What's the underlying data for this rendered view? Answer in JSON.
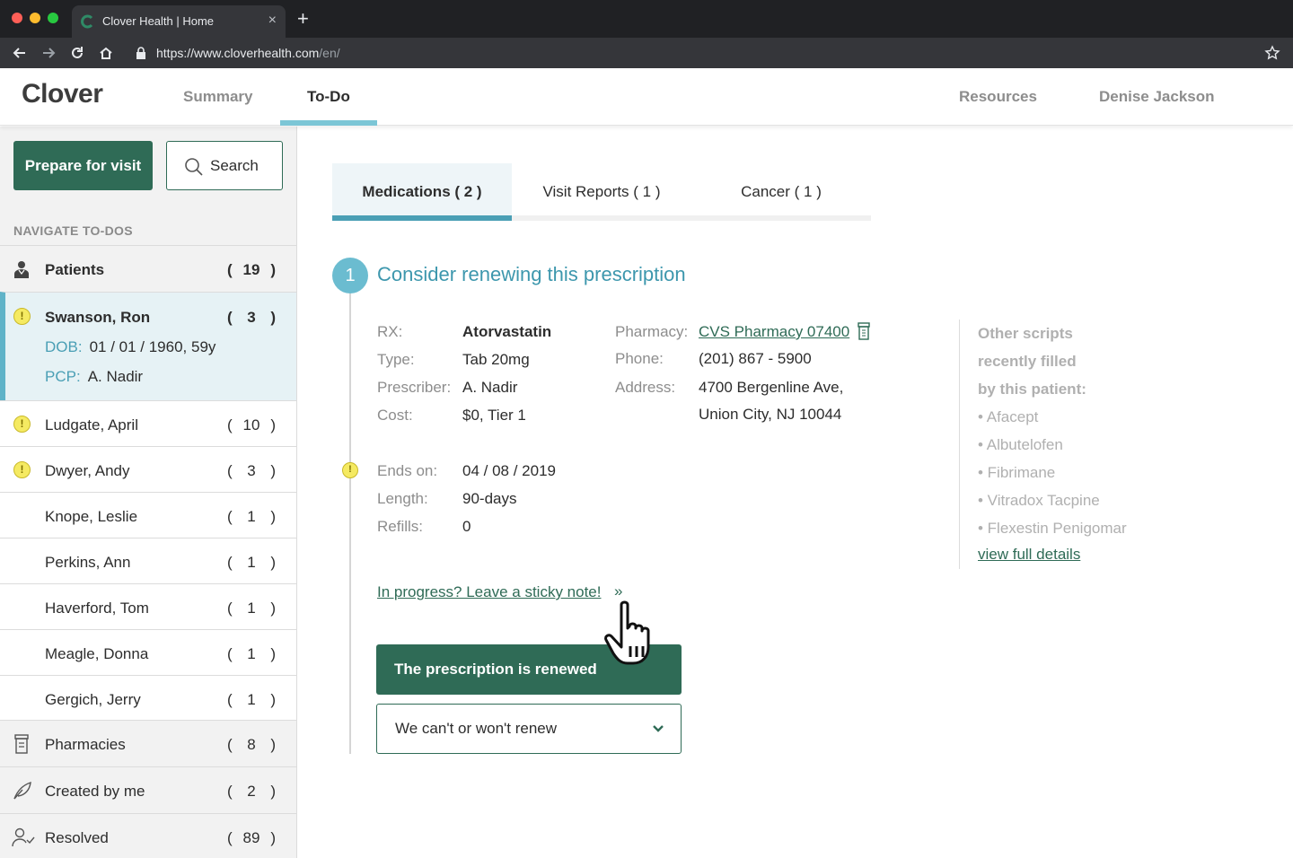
{
  "browser": {
    "tab_title": "Clover Health | Home",
    "url_main": "https://www.cloverhealth.com",
    "url_path": "/en/"
  },
  "header": {
    "logo": "Clover",
    "nav": {
      "summary": "Summary",
      "todo": "To-Do"
    },
    "resources": "Resources",
    "user_name": "Denise Jackson"
  },
  "sidebar": {
    "prepare_button": "Prepare for visit",
    "search_button": "Search",
    "heading": "NAVIGATE TO-DOS",
    "patients": {
      "label": "Patients",
      "count": "19"
    },
    "selected_patient": {
      "name": "Swanson, Ron",
      "count": "3",
      "dob_key": "DOB:",
      "dob_value": "01 / 01 / 1960, 59y",
      "pcp_key": "PCP:",
      "pcp_value": "A. Nadir"
    },
    "patient_rows": [
      {
        "name": "Ludgate, April",
        "count": "10",
        "alert": true
      },
      {
        "name": "Dwyer, Andy",
        "count": "3",
        "alert": true
      },
      {
        "name": "Knope, Leslie",
        "count": "1",
        "alert": false
      },
      {
        "name": "Perkins, Ann",
        "count": "1",
        "alert": false
      },
      {
        "name": "Haverford, Tom",
        "count": "1",
        "alert": false
      },
      {
        "name": "Meagle, Donna",
        "count": "1",
        "alert": false
      },
      {
        "name": "Gergich, Jerry",
        "count": "1",
        "alert": false
      }
    ],
    "pharmacies": {
      "label": "Pharmacies",
      "count": "8"
    },
    "created_by_me": {
      "label": "Created by me",
      "count": "2"
    },
    "resolved": {
      "label": "Resolved",
      "count": "89"
    },
    "paren_open": "(",
    "paren_close": ")"
  },
  "main": {
    "tabs": [
      {
        "label": "Medications ( 2 )"
      },
      {
        "label": "Visit Reports ( 1 )"
      },
      {
        "label": "Cancer ( 1 )"
      }
    ],
    "step_number": "1",
    "step_title": "Consider renewing this prescription",
    "rx": {
      "rx_key": "RX:",
      "rx_value": "Atorvastatin",
      "type_key": "Type:",
      "type_value": "Tab 20mg",
      "prescriber_key": "Prescriber:",
      "prescriber_value": "A. Nadir",
      "cost_key": "Cost:",
      "cost_value": "$0, Tier 1"
    },
    "pharmacy": {
      "pharmacy_key": "Pharmacy:",
      "pharmacy_value": "CVS Pharmacy 07400",
      "phone_key": "Phone:",
      "phone_value": "(201)  867 - 5900",
      "address_key": "Address:",
      "address_line1": "4700 Bergenline Ave,",
      "address_line2": "Union City, NJ  10044"
    },
    "dates": {
      "ends_key": "Ends on:",
      "ends_value": "04 / 08 / 2019",
      "length_key": "Length:",
      "length_value": "90-days",
      "refills_key": "Refills:",
      "refills_value": "0"
    },
    "other_scripts": {
      "heading_lines": [
        "Other scripts",
        "recently filled",
        "by this patient:"
      ],
      "items": [
        "• Afacept",
        "• Albutelofen",
        "• Fibrimane",
        "• Vitradox Tacpine",
        "• Flexestin Penigomar"
      ],
      "link": "view full details"
    },
    "sticky_link": "In progress?  Leave a sticky note!",
    "sticky_chevron": "»",
    "renewed_button": "The prescription is renewed",
    "wont_renew_select": "We can't or won't renew"
  },
  "colors": {
    "brand_green": "#2f6b56",
    "accent_teal": "#4a9fb5",
    "alert_yellow": "#f5ea62"
  }
}
